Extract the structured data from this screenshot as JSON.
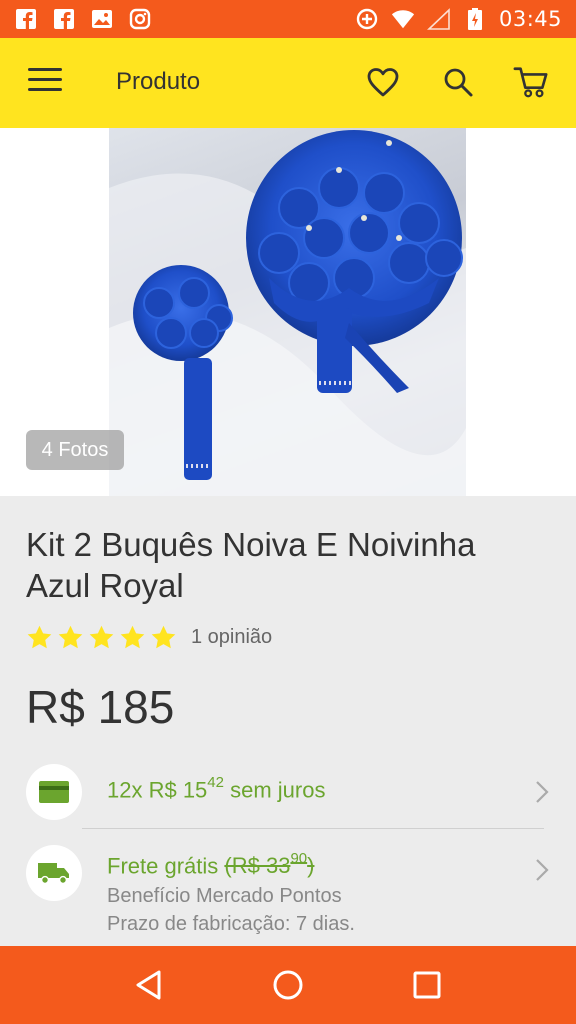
{
  "status_bar": {
    "time": "03:45",
    "left_icons": [
      "facebook-icon",
      "facebook-icon",
      "image-icon",
      "instagram-icon"
    ],
    "right_icons": [
      "data-saver-icon",
      "wifi-icon",
      "signal-icon",
      "battery-charging-icon"
    ]
  },
  "app_bar": {
    "title": "Produto",
    "icons": [
      "menu-icon",
      "heart-icon",
      "search-icon",
      "cart-icon"
    ]
  },
  "gallery": {
    "photos_badge": "4 Fotos"
  },
  "product": {
    "title": "Kit 2 Buquês Noiva E Noivinha Azul Royal",
    "rating": {
      "stars": 5,
      "max": 5,
      "reviews": "1 opinião"
    },
    "price": "R$ 185"
  },
  "installments": {
    "prefix": "12x R$ 15",
    "cents": "42",
    "suffix": "sem juros"
  },
  "shipping": {
    "label": "Frete grátis",
    "old_price_int": "(R$ 33",
    "old_price_cents": "90",
    "old_price_close": ")",
    "benefit": "Benefício Mercado Pontos",
    "lead_time": "Prazo de fabricação: 7 dias."
  },
  "colors": {
    "status_bar": "#f45a1c",
    "app_bar": "#ffe41f",
    "accent_green": "#6ba52e",
    "star": "#ffe41f"
  },
  "nav_bar": {
    "icons": [
      "back-icon",
      "home-icon",
      "recents-icon"
    ]
  }
}
